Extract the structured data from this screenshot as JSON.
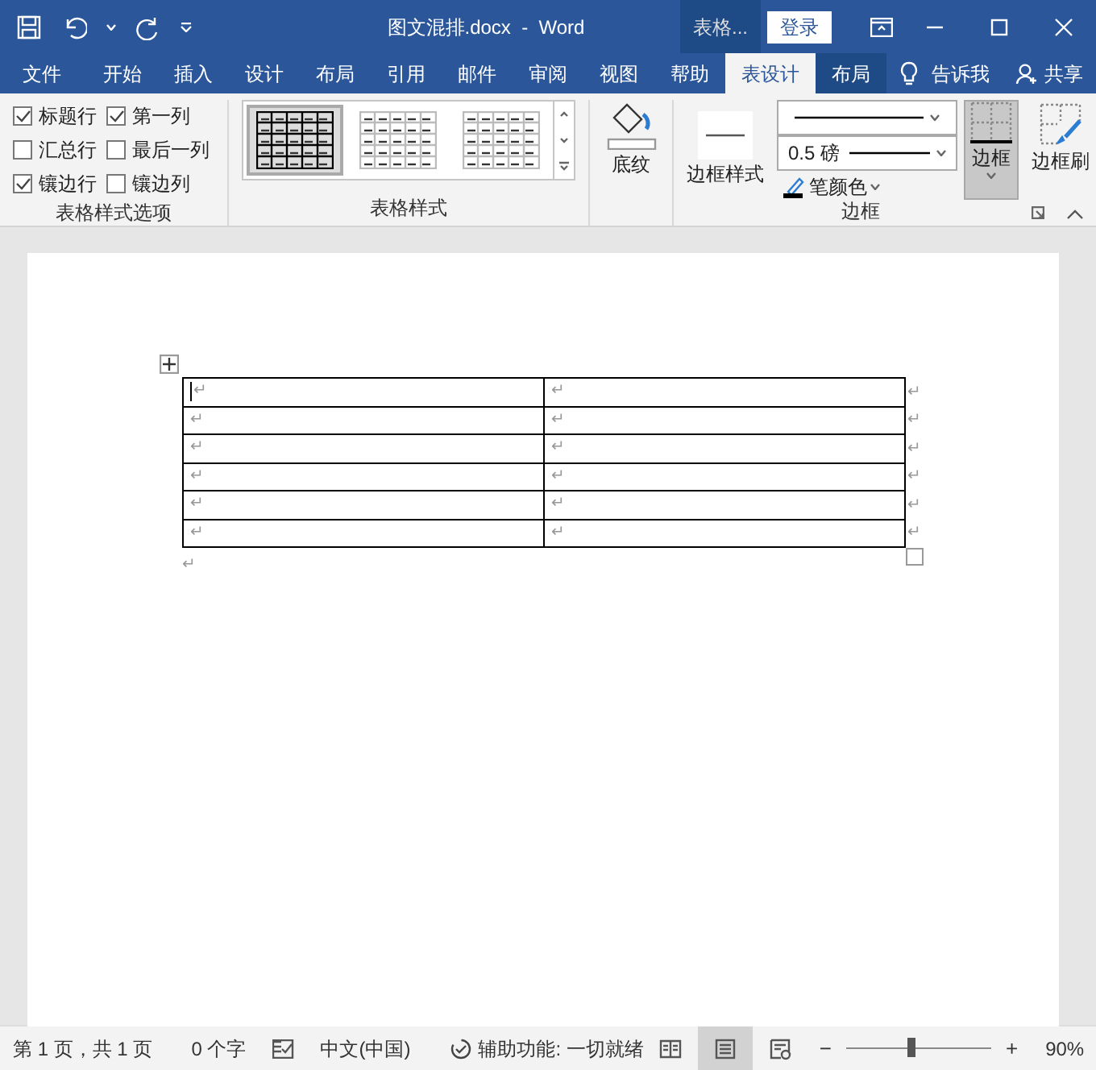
{
  "title_bar": {
    "title": "图文混排.docx  -  Word",
    "context_label": "表格...",
    "sign_in": "登录"
  },
  "tabs": [
    {
      "label": "文件",
      "kind": "normal",
      "selected": false
    },
    {
      "label": "开始",
      "kind": "normal",
      "selected": false
    },
    {
      "label": "插入",
      "kind": "normal",
      "selected": false
    },
    {
      "label": "设计",
      "kind": "normal",
      "selected": false
    },
    {
      "label": "布局",
      "kind": "normal",
      "selected": false
    },
    {
      "label": "引用",
      "kind": "normal",
      "selected": false
    },
    {
      "label": "邮件",
      "kind": "normal",
      "selected": false
    },
    {
      "label": "审阅",
      "kind": "normal",
      "selected": false
    },
    {
      "label": "视图",
      "kind": "normal",
      "selected": false
    },
    {
      "label": "帮助",
      "kind": "normal",
      "selected": false
    },
    {
      "label": "表设计",
      "kind": "contextual",
      "selected": true
    },
    {
      "label": "布局",
      "kind": "contextual",
      "selected": false
    }
  ],
  "tell_me": "告诉我",
  "share": "共享",
  "ribbon": {
    "style_options": {
      "label": "表格样式选项",
      "checkboxes": [
        {
          "label": "标题行",
          "checked": true
        },
        {
          "label": "第一列",
          "checked": true
        },
        {
          "label": "汇总行",
          "checked": false
        },
        {
          "label": "最后一列",
          "checked": false
        },
        {
          "label": "镶边行",
          "checked": true
        },
        {
          "label": "镶边列",
          "checked": false
        }
      ]
    },
    "table_styles": {
      "label": "表格样式",
      "styles": [
        {
          "selected": true
        },
        {
          "selected": false
        },
        {
          "selected": false
        }
      ]
    },
    "shading": {
      "label": "底纹"
    },
    "borders": {
      "label": "边框",
      "border_styles": "边框样式",
      "weight": "0.5 磅",
      "pen_color": "笔颜色",
      "borders_button": {
        "label": "边框",
        "pressed": true
      },
      "border_painter": "边框刷"
    }
  },
  "document": {
    "table": {
      "rows": [
        {
          "cells": [
            {
              "text": "↵",
              "caret": true
            },
            {
              "text": "↵",
              "caret": false
            }
          ],
          "end_mark": "↵"
        },
        {
          "cells": [
            {
              "text": "↵",
              "caret": false
            },
            {
              "text": "↵",
              "caret": false
            }
          ],
          "end_mark": "↵"
        },
        {
          "cells": [
            {
              "text": "↵",
              "caret": false
            },
            {
              "text": "↵",
              "caret": false
            }
          ],
          "end_mark": "↵"
        },
        {
          "cells": [
            {
              "text": "↵",
              "caret": false
            },
            {
              "text": "↵",
              "caret": false
            }
          ],
          "end_mark": "↵"
        },
        {
          "cells": [
            {
              "text": "↵",
              "caret": false
            },
            {
              "text": "↵",
              "caret": false
            }
          ],
          "end_mark": "↵"
        },
        {
          "cells": [
            {
              "text": "↵",
              "caret": false
            },
            {
              "text": "↵",
              "caret": false
            }
          ],
          "end_mark": "↵"
        }
      ]
    },
    "paragraph_mark": "↵"
  },
  "status_bar": {
    "page": "第 1 页，共 1 页",
    "words": "0 个字",
    "language": "中文(中国)",
    "accessibility": "辅助功能: 一切就绪",
    "views": [
      {
        "kind": "read",
        "selected": false
      },
      {
        "kind": "print",
        "selected": true
      },
      {
        "kind": "web",
        "selected": false
      }
    ],
    "zoom_out": "−",
    "zoom_slider": {
      "level": 0.45
    },
    "zoom_in": "+",
    "zoom": "90%"
  }
}
